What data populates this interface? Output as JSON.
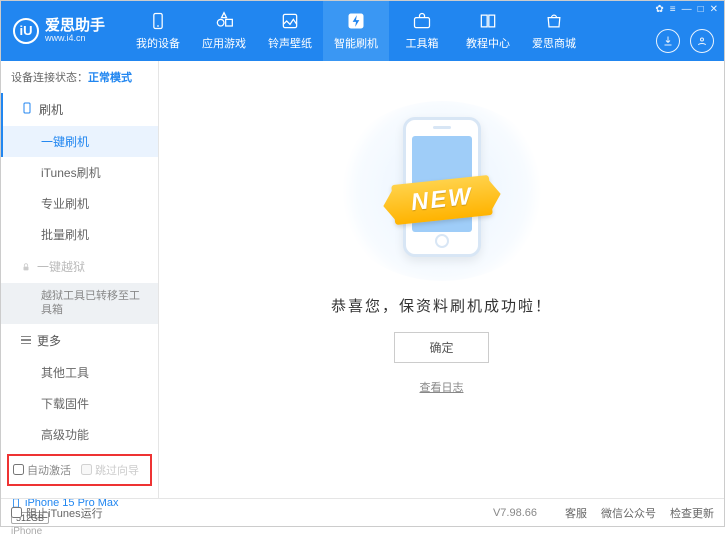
{
  "app": {
    "title": "爱思助手",
    "url": "www.i4.cn",
    "logo_letter": "iU"
  },
  "win": {
    "skin": "✿",
    "menu": "≡",
    "min": "—",
    "max": "□",
    "close": "✕"
  },
  "nav": [
    {
      "label": "我的设备",
      "icon": "device"
    },
    {
      "label": "应用游戏",
      "icon": "apps"
    },
    {
      "label": "铃声壁纸",
      "icon": "media"
    },
    {
      "label": "智能刷机",
      "icon": "flash",
      "active": true
    },
    {
      "label": "工具箱",
      "icon": "tools"
    },
    {
      "label": "教程中心",
      "icon": "book"
    },
    {
      "label": "爱思商城",
      "icon": "shop"
    }
  ],
  "status": {
    "label": "设备连接状态：",
    "mode": "正常模式"
  },
  "sections": {
    "flash": {
      "title": "刷机",
      "items": [
        {
          "label": "一键刷机",
          "active": true
        },
        {
          "label": "iTunes刷机"
        },
        {
          "label": "专业刷机"
        },
        {
          "label": "批量刷机"
        }
      ]
    },
    "jailbreak": {
      "title": "一键越狱",
      "note": "越狱工具已转移至工具箱"
    },
    "more": {
      "title": "更多",
      "items": [
        {
          "label": "其他工具"
        },
        {
          "label": "下载固件"
        },
        {
          "label": "高级功能"
        }
      ]
    }
  },
  "checks": {
    "auto_activate": "自动激活",
    "skip_guide": "跳过向导"
  },
  "device": {
    "name": "iPhone 15 Pro Max",
    "storage": "512GB",
    "type": "iPhone"
  },
  "main": {
    "ribbon": "NEW",
    "text": "恭喜您，保资料刷机成功啦！",
    "ok": "确定",
    "log": "查看日志"
  },
  "footer": {
    "block_itunes": "阻止iTunes运行",
    "version": "V7.98.66",
    "links": [
      "客服",
      "微信公众号",
      "检查更新"
    ]
  }
}
